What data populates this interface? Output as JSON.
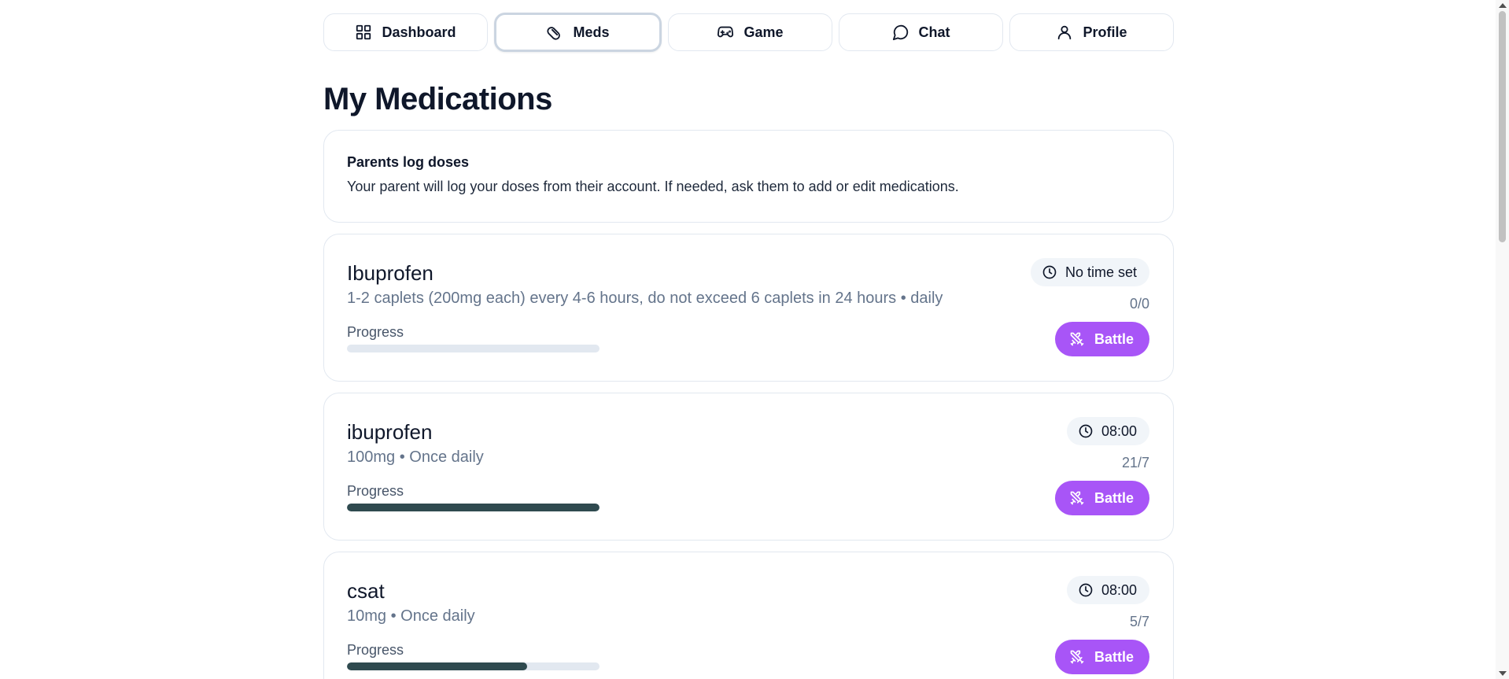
{
  "nav": {
    "items": [
      {
        "label": "Dashboard",
        "icon": "grid-icon",
        "active": false
      },
      {
        "label": "Meds",
        "icon": "pill-icon",
        "active": true
      },
      {
        "label": "Game",
        "icon": "gamepad-icon",
        "active": false
      },
      {
        "label": "Chat",
        "icon": "chat-bubble-icon",
        "active": false
      },
      {
        "label": "Profile",
        "icon": "user-icon",
        "active": false
      }
    ]
  },
  "page": {
    "title": "My Medications"
  },
  "notice": {
    "title": "Parents log doses",
    "text": "Your parent will log your doses from their account. If needed, ask them to add or edit medications."
  },
  "medications": [
    {
      "name": "Ibuprofen",
      "description": "1-2 caplets (200mg each) every 4-6 hours, do not exceed 6 caplets in 24 hours • daily",
      "time": "No time set",
      "count": "0/0",
      "progress_label": "Progress",
      "progress": 0,
      "battle_label": "Battle"
    },
    {
      "name": "ibuprofen",
      "description": "100mg • Once daily",
      "time": "08:00",
      "count": "21/7",
      "progress_label": "Progress",
      "progress": 1.0,
      "battle_label": "Battle"
    },
    {
      "name": "csat",
      "description": "10mg • Once daily",
      "time": "08:00",
      "count": "5/7",
      "progress_label": "Progress",
      "progress": 0.714,
      "battle_label": "Battle"
    }
  ],
  "colors": {
    "accent": "#a855f7",
    "progress_fill": "#2f4a4f",
    "progress_track": "#e2e8f0"
  }
}
